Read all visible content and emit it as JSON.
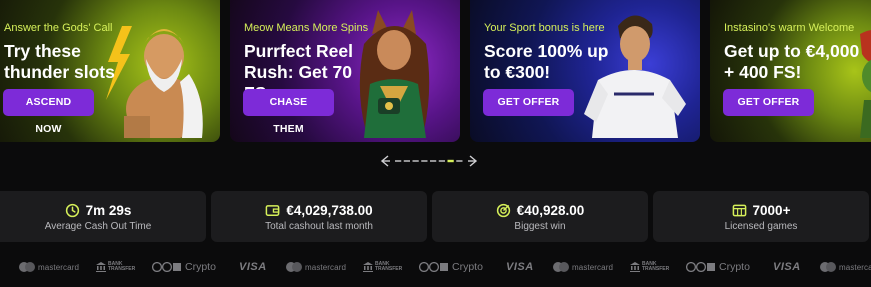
{
  "promos": [
    {
      "eyebrow": "Answer the Gods' Call",
      "title": "Try these thunder slots",
      "button": "ASCEND NOW"
    },
    {
      "eyebrow": "Meow Means More Spins",
      "title": "Purrfect Reel Rush: Get 70 FS",
      "button": "CHASE THEM"
    },
    {
      "eyebrow": "Your Sport bonus is here",
      "title": "Score 100% up to €300!",
      "button": "GET OFFER"
    },
    {
      "eyebrow": "Instasino's warm Welcome",
      "title": "Get up to €4,000 + 400 FS!",
      "button": "GET OFFER"
    }
  ],
  "pager": {
    "total": 8,
    "active": 7,
    "accent": "#d6f05a"
  },
  "stats": [
    {
      "icon": "clock-icon",
      "value": "7m 29s",
      "label": "Average Cash Out Time"
    },
    {
      "icon": "wallet-icon",
      "value": "€4,029,738.00",
      "label": "Total cashout last month"
    },
    {
      "icon": "target-icon",
      "value": "€40,928.00",
      "label": "Biggest win"
    },
    {
      "icon": "slot-machine-icon",
      "value": "7000+",
      "label": "Licensed games"
    }
  ],
  "payments": {
    "mastercard": "mastercard",
    "bank_line1": "BANK",
    "bank_line2": "TRANSFER",
    "crypto": "Crypto",
    "visa": "VISA"
  },
  "colors": {
    "accent": "#d6f05a",
    "button": "#7d2bd8",
    "card_bg": "#1c1c1e"
  }
}
